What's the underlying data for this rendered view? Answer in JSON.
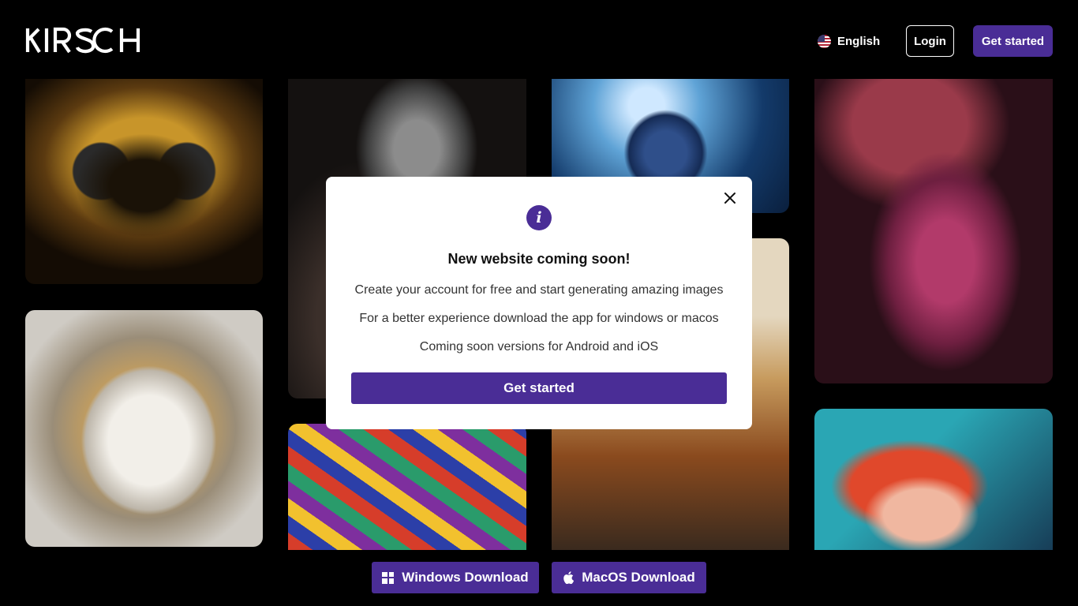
{
  "header": {
    "logo_text": "KIRSCH",
    "language_label": "English",
    "login_label": "Login",
    "get_started_label": "Get started"
  },
  "gallery": [
    "bee-macro",
    "white-wolf",
    "elder-portrait",
    "colorful-houses",
    "blue-knight",
    "old-city",
    "fan-dancer",
    "anime-girl"
  ],
  "downloads": {
    "windows_label": "Windows Download",
    "macos_label": "MacOS Download"
  },
  "modal": {
    "title": "New website coming soon!",
    "line1": "Create your account for free and start generating amazing images",
    "line2": "For a better experience download the app for windows or macos",
    "line3": "Coming soon versions for Android and iOS",
    "cta_label": "Get started"
  },
  "colors": {
    "accent": "#4a2d96",
    "background": "#000000",
    "modal_bg": "#ffffff"
  }
}
